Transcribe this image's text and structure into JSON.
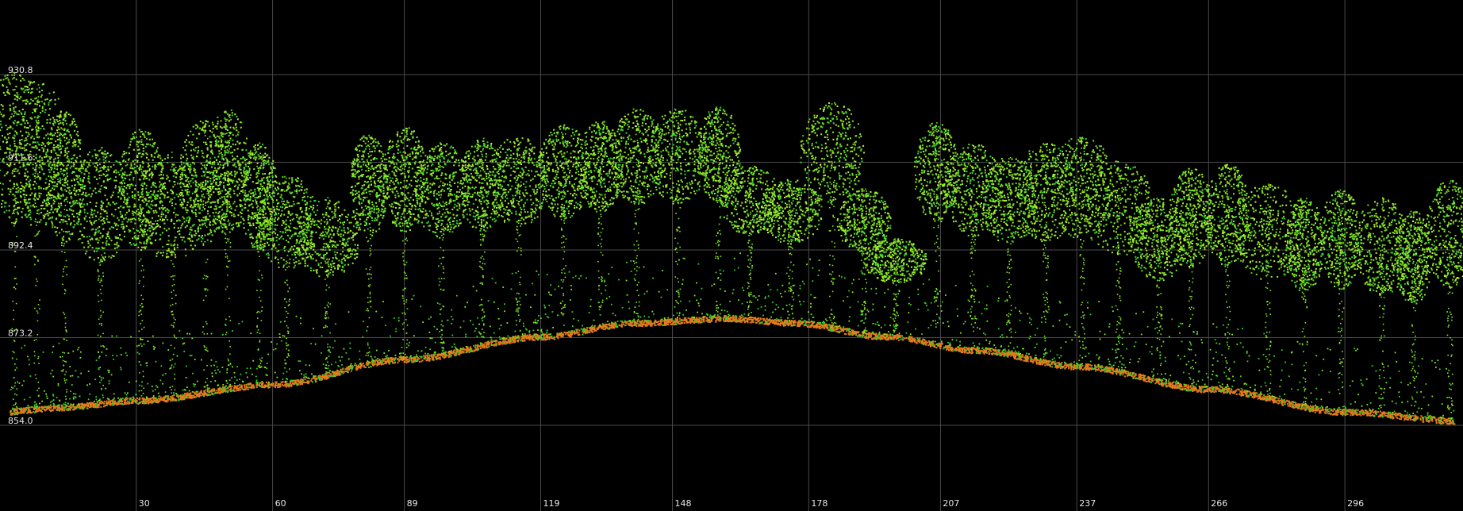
{
  "chart_data": {
    "type": "scatter",
    "title": "",
    "xlabel": "",
    "ylabel": "",
    "background": "#000000",
    "grid": true,
    "grid_color": "#4a4a4a",
    "x_ticks": [
      30,
      60,
      89,
      119,
      148,
      178,
      207,
      237,
      266,
      296
    ],
    "y_ticks": [
      930.8,
      911.6,
      892.4,
      873.2,
      854.0
    ],
    "xlim": [
      0,
      322
    ],
    "ylim": [
      854.0,
      930.8
    ],
    "series": [
      {
        "color": "#e87a1c",
        "role": "ground"
      },
      {
        "color": "#86e81f",
        "role": "vegetation"
      },
      {
        "color": "#2fd12f",
        "role": "low-vegetation"
      }
    ],
    "ground_profile": [
      {
        "x": 0,
        "y": 857.0
      },
      {
        "x": 13,
        "y": 858.0
      },
      {
        "x": 30,
        "y": 859.5
      },
      {
        "x": 60,
        "y": 863.0
      },
      {
        "x": 89,
        "y": 868.5
      },
      {
        "x": 119,
        "y": 873.5
      },
      {
        "x": 140,
        "y": 876.5
      },
      {
        "x": 160,
        "y": 877.5
      },
      {
        "x": 175,
        "y": 876.5
      },
      {
        "x": 195,
        "y": 873.5
      },
      {
        "x": 215,
        "y": 870.5
      },
      {
        "x": 237,
        "y": 867.0
      },
      {
        "x": 266,
        "y": 862.0
      },
      {
        "x": 296,
        "y": 857.0
      },
      {
        "x": 322,
        "y": 855.0
      }
    ],
    "tree_tops": [
      {
        "x": 3,
        "h": 931.5
      },
      {
        "x": 8,
        "h": 930.0
      },
      {
        "x": 14,
        "h": 923.0
      },
      {
        "x": 22,
        "h": 915.0
      },
      {
        "x": 31,
        "h": 919.0
      },
      {
        "x": 38,
        "h": 914.0
      },
      {
        "x": 45,
        "h": 921.0
      },
      {
        "x": 50,
        "h": 923.5
      },
      {
        "x": 57,
        "h": 916.0
      },
      {
        "x": 63,
        "h": 909.0
      },
      {
        "x": 72,
        "h": 904.0
      },
      {
        "x": 81,
        "h": 918.0
      },
      {
        "x": 89,
        "h": 919.5
      },
      {
        "x": 97,
        "h": 916.0
      },
      {
        "x": 106,
        "h": 917.0
      },
      {
        "x": 114,
        "h": 917.5
      },
      {
        "x": 124,
        "h": 920.0
      },
      {
        "x": 132,
        "h": 921.0
      },
      {
        "x": 140,
        "h": 923.5
      },
      {
        "x": 149,
        "h": 923.5
      },
      {
        "x": 158,
        "h": 924.0
      },
      {
        "x": 165,
        "h": 911.0
      },
      {
        "x": 174,
        "h": 908.0
      },
      {
        "x": 183,
        "h": 925.0
      },
      {
        "x": 190,
        "h": 906.0
      },
      {
        "x": 197,
        "h": 895.0
      },
      {
        "x": 206,
        "h": 920.5
      },
      {
        "x": 214,
        "h": 916.0
      },
      {
        "x": 222,
        "h": 913.0
      },
      {
        "x": 230,
        "h": 916.0
      },
      {
        "x": 238,
        "h": 917.5
      },
      {
        "x": 246,
        "h": 912.0
      },
      {
        "x": 255,
        "h": 904.0
      },
      {
        "x": 262,
        "h": 910.5
      },
      {
        "x": 270,
        "h": 911.5
      },
      {
        "x": 279,
        "h": 907.0
      },
      {
        "x": 287,
        "h": 904.0
      },
      {
        "x": 295,
        "h": 906.0
      },
      {
        "x": 304,
        "h": 904.0
      },
      {
        "x": 311,
        "h": 901.0
      },
      {
        "x": 319,
        "h": 908.0
      }
    ]
  }
}
